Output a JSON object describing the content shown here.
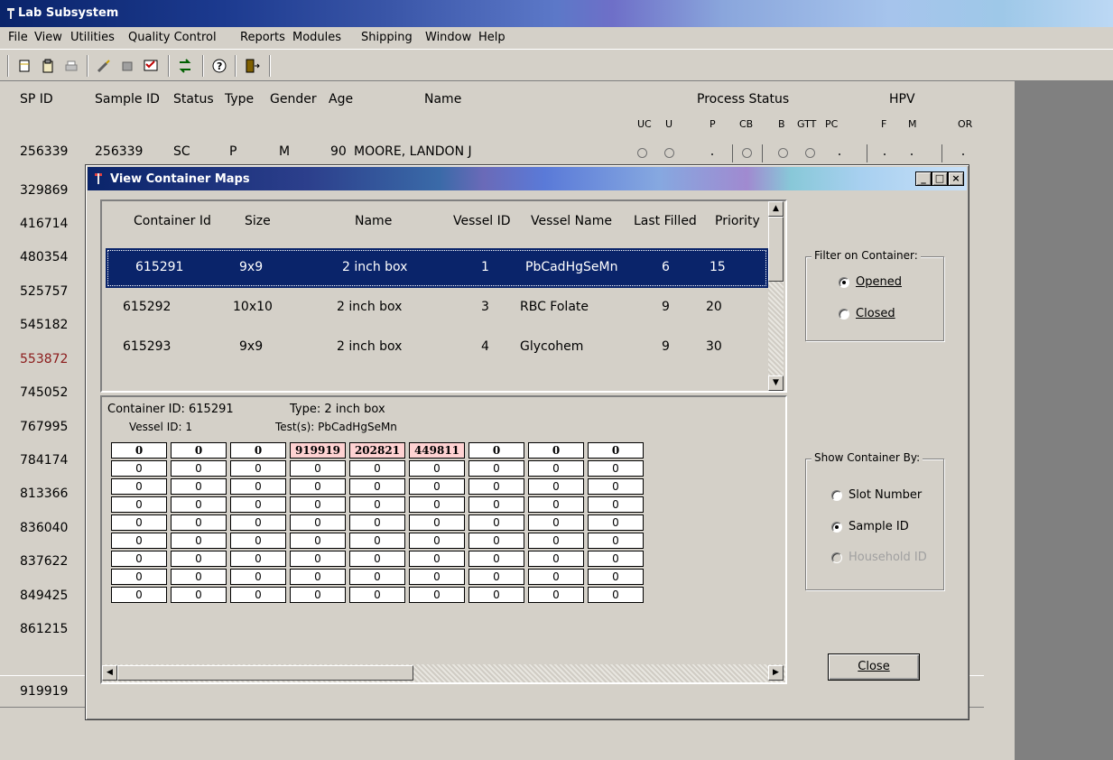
{
  "app": {
    "title": "Lab Subsystem"
  },
  "menu": [
    "File",
    "View",
    "Utilities",
    "Quality Control",
    "Reports",
    "Modules",
    "Shipping",
    "Window",
    "Help"
  ],
  "columns": {
    "sp_id": "SP ID",
    "sample_id": "Sample ID",
    "status": "Status",
    "type": "Type",
    "gender": "Gender",
    "age": "Age",
    "name": "Name",
    "process_status": "Process Status",
    "hpv": "HPV",
    "sub": [
      "UC",
      "U",
      "P",
      "CB",
      "B",
      "GTT",
      "PC",
      "F",
      "M",
      "OR"
    ]
  },
  "first_row": {
    "sp_id": "256339",
    "sample_id": "256339",
    "status": "SC",
    "type": "P",
    "gender": "M",
    "age": "90",
    "name": "MOORE, LANDON J"
  },
  "sp_ids": [
    "329869",
    "416714",
    "480354",
    "525757",
    "545182",
    "553872",
    "745052",
    "767995",
    "784174",
    "813366",
    "836040",
    "837622",
    "849425",
    "861215",
    "919919"
  ],
  "highlight_color": "#8b1a1a",
  "dialog": {
    "title": "View Container Maps",
    "minimize": "_",
    "restore": "□",
    "close": "×",
    "list": {
      "headers": {
        "container_id": "Container Id",
        "size": "Size",
        "name": "Name",
        "vessel_id": "Vessel ID",
        "vessel_name": "Vessel Name",
        "last_filled": "Last Filled",
        "priority": "Priority"
      },
      "rows": [
        {
          "container_id": "615291",
          "size": "9x9",
          "name": "2 inch box",
          "vessel_id": "1",
          "vessel_name": "PbCadHgSeMn",
          "last_filled": "6",
          "priority": "15"
        },
        {
          "container_id": "615292",
          "size": "10x10",
          "name": "2 inch box",
          "vessel_id": "3",
          "vessel_name": "RBC Folate",
          "last_filled": "9",
          "priority": "20"
        },
        {
          "container_id": "615293",
          "size": "9x9",
          "name": "2 inch box",
          "vessel_id": "4",
          "vessel_name": "Glycohem",
          "last_filled": "9",
          "priority": "30"
        }
      ]
    },
    "map": {
      "container_line": "Container ID: 615291",
      "type_line": "Type: 2 inch box",
      "vessel_line": "Vessel ID: 1",
      "tests_line": "Test(s): PbCadHgSeMn",
      "grid": [
        [
          "0",
          "0",
          "0",
          "919919",
          "202821",
          "449811",
          "0",
          "0",
          "0"
        ],
        [
          "0",
          "0",
          "0",
          "0",
          "0",
          "0",
          "0",
          "0",
          "0"
        ],
        [
          "0",
          "0",
          "0",
          "0",
          "0",
          "0",
          "0",
          "0",
          "0"
        ],
        [
          "0",
          "0",
          "0",
          "0",
          "0",
          "0",
          "0",
          "0",
          "0"
        ],
        [
          "0",
          "0",
          "0",
          "0",
          "0",
          "0",
          "0",
          "0",
          "0"
        ],
        [
          "0",
          "0",
          "0",
          "0",
          "0",
          "0",
          "0",
          "0",
          "0"
        ],
        [
          "0",
          "0",
          "0",
          "0",
          "0",
          "0",
          "0",
          "0",
          "0"
        ],
        [
          "0",
          "0",
          "0",
          "0",
          "0",
          "0",
          "0",
          "0",
          "0"
        ],
        [
          "0",
          "0",
          "0",
          "0",
          "0",
          "0",
          "0",
          "0",
          "0"
        ]
      ]
    },
    "filter": {
      "label": "Filter on Container:",
      "opened": "Opened",
      "closed": "Closed",
      "selected": "opened"
    },
    "show_by": {
      "label": "Show Container By:",
      "slot": "Slot Number",
      "sample": "Sample ID",
      "household": "Household ID",
      "selected": "sample"
    },
    "close_button": "Close"
  }
}
